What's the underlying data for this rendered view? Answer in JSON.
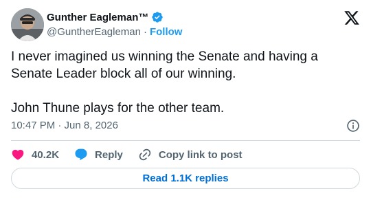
{
  "author": {
    "display_name": "Gunther Eagleman™",
    "handle": "@GuntherEagleman",
    "separator": "·",
    "follow_label": "Follow",
    "verified": true
  },
  "tweet": {
    "text": "I never imagined us winning the Senate and having a Senate Leader block all of our winning.\n\nJohn Thune plays for the other team.",
    "timestamp": "10:47 PM · Jun 8, 2026"
  },
  "actions": {
    "likes": "40.2K",
    "reply_label": "Reply",
    "copy_link_label": "Copy link to post"
  },
  "read_replies_label": "Read 1.1K replies",
  "colors": {
    "accent": "#1d9bf0",
    "like": "#f91880",
    "text": "#0f1419",
    "secondary": "#536471",
    "border": "#cfd9de"
  },
  "icons": [
    "avatar",
    "verified-badge-icon",
    "x-logo-icon",
    "info-icon",
    "heart-icon",
    "reply-bubble-icon",
    "link-icon"
  ]
}
